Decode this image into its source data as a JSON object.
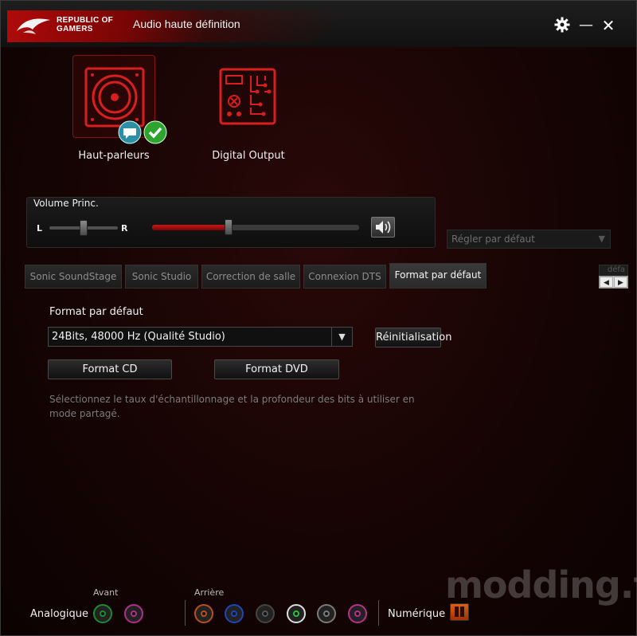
{
  "titlebar": {
    "brand_line1": "REPUBLIC OF",
    "brand_line2": "GAMERS",
    "title": "Audio haute définition",
    "gear_icon": "gear-icon",
    "minimize_glyph": "—",
    "close_glyph": "✕"
  },
  "devices": [
    {
      "label": "Haut-parleurs",
      "icon": "speaker-icon",
      "selected": true
    },
    {
      "label": "Digital Output",
      "icon": "circuit-board-icon",
      "selected": false
    }
  ],
  "volume": {
    "title": "Volume Princ.",
    "left_label": "L",
    "right_label": "R",
    "balance": 0.5,
    "level": 0.37
  },
  "default_device_select": {
    "value": "Régler par défaut"
  },
  "tabs": [
    {
      "label": "Sonic SoundStage",
      "active": false
    },
    {
      "label": "Sonic Studio",
      "active": false
    },
    {
      "label": "Correction de salle",
      "active": false
    },
    {
      "label": "Connexion DTS",
      "active": false
    },
    {
      "label": "Format par défaut",
      "active": true
    }
  ],
  "tab_overflow_text": "défa",
  "content": {
    "section_title": "Format par défaut",
    "format_value": "24Bits, 48000 Hz (Qualité Studio)",
    "reset_label": "Réinitialisation",
    "cd_label": "Format CD",
    "dvd_label": "Format DVD",
    "description": "Sélectionnez le taux d'échantillonnage et la profondeur des bits à utiliser en mode partagé."
  },
  "jacks": {
    "analog_label": "Analogique",
    "front_label": "Avant",
    "rear_label": "Arrière",
    "digital_label": "Numérique",
    "front_colors": [
      "#1e8a2e",
      "#b0308a"
    ],
    "rear_colors": [
      "#b8501e",
      "#1f46b8",
      "#333333",
      "#2fbf3a",
      "#7a7a7a",
      "#b8308c"
    ]
  },
  "watermark": "modding.fr"
}
